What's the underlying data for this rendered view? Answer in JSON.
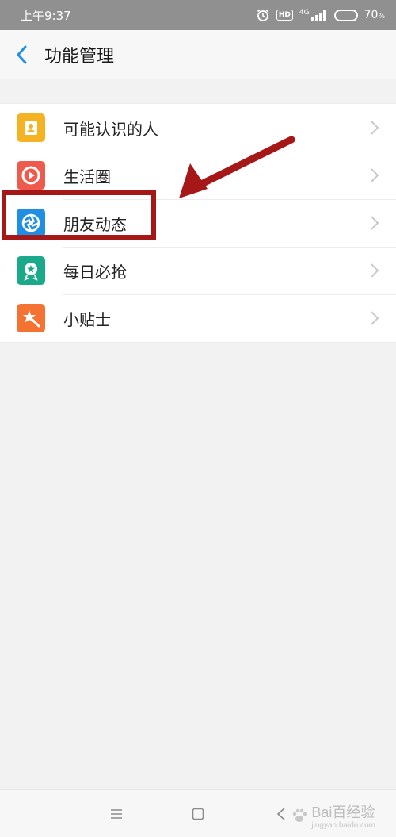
{
  "status_bar": {
    "time": "上午9:37",
    "network": "4G",
    "battery": "70",
    "battery_unit": "%",
    "battery_level": 0.7
  },
  "header": {
    "title": "功能管理",
    "back_icon": "chevron-left-icon"
  },
  "list": {
    "items": [
      {
        "label": "可能认识的人",
        "icon": "contacts-book-icon",
        "color": "#f5b223"
      },
      {
        "label": "生活圈",
        "icon": "play-circle-icon",
        "color": "#ee5b4d"
      },
      {
        "label": "朋友动态",
        "icon": "aperture-icon",
        "color": "#1f8fe3"
      },
      {
        "label": "每日必抢",
        "icon": "star-badge-icon",
        "color": "#1aa98a"
      },
      {
        "label": "小贴士",
        "icon": "magic-wand-star-icon",
        "color": "#f47232"
      }
    ]
  },
  "annotation": {
    "highlight_color": "#a61717"
  },
  "nav_bar": {
    "menu_icon": "menu-icon",
    "home_icon": "home-square-icon",
    "back_icon": "back-triangle-icon"
  },
  "watermark": {
    "text": "Bai百经验",
    "sub": "jingyan.baidu.com"
  }
}
